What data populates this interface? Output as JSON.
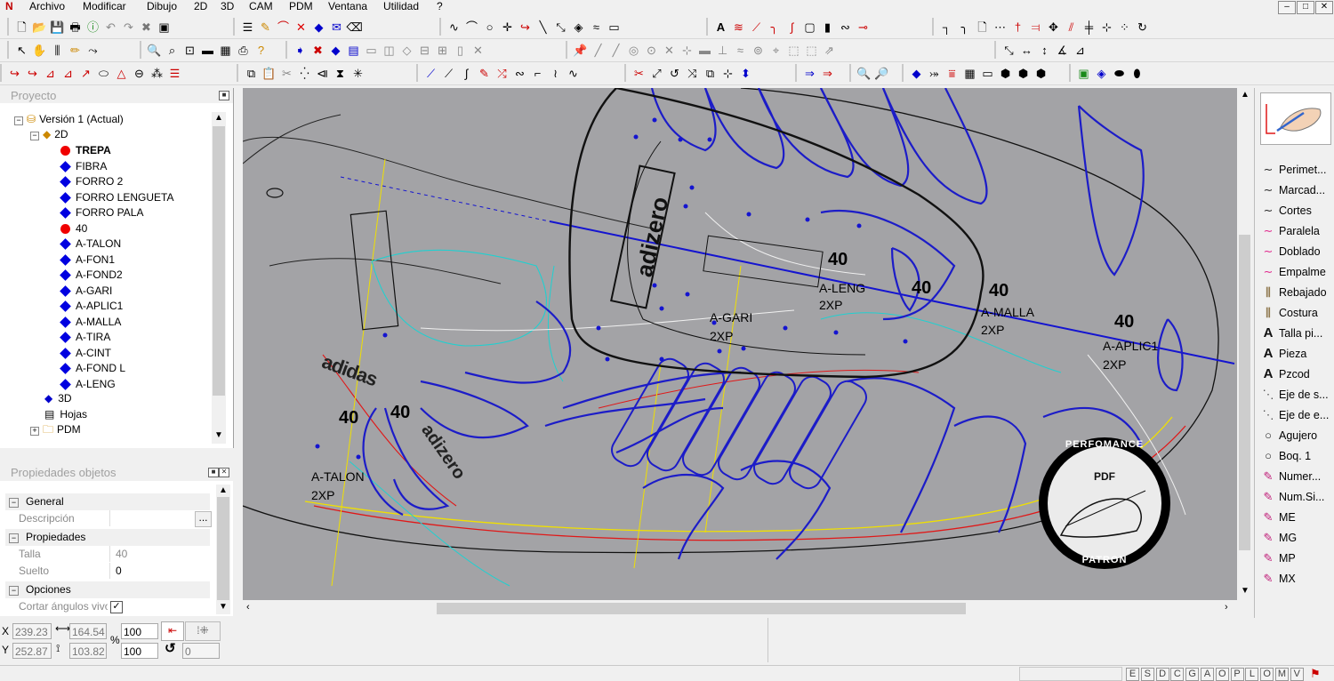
{
  "menu": [
    "Archivo",
    "Modificar",
    "Dibujo",
    "2D",
    "3D",
    "CAM",
    "PDM",
    "Ventana",
    "Utilidad",
    "?"
  ],
  "window_controls": [
    "–",
    "□",
    "✕"
  ],
  "project_panel": {
    "title": "Proyecto",
    "root": "Versión 1 (Actual)",
    "folder_2d": "2D",
    "pieces": [
      {
        "label": "TREPA",
        "color": "red",
        "bold": true
      },
      {
        "label": "FIBRA",
        "color": "blue"
      },
      {
        "label": "FORRO 2",
        "color": "blue"
      },
      {
        "label": "FORRO LENGUETA",
        "color": "blue"
      },
      {
        "label": "FORRO PALA",
        "color": "blue"
      },
      {
        "label": "40",
        "color": "red"
      },
      {
        "label": "A-TALON",
        "color": "blue"
      },
      {
        "label": "A-FON1",
        "color": "blue"
      },
      {
        "label": "A-FOND2",
        "color": "blue"
      },
      {
        "label": "A-GARI",
        "color": "blue"
      },
      {
        "label": "A-APLIC1",
        "color": "blue"
      },
      {
        "label": "A-MALLA",
        "color": "blue"
      },
      {
        "label": "A-TIRA",
        "color": "blue"
      },
      {
        "label": "A-CINT",
        "color": "blue"
      },
      {
        "label": "A-FOND L",
        "color": "blue"
      },
      {
        "label": "A-LENG",
        "color": "blue"
      }
    ],
    "node_3d": "3D",
    "node_hojas": "Hojas",
    "node_pdm": "PDM"
  },
  "props_panel": {
    "title": "Propiedades objetos",
    "general": "General",
    "descripcion_label": "Descripción",
    "descripcion_btn": "...",
    "propiedades": "Propiedades",
    "talla_label": "Talla",
    "talla_value": "40",
    "suelto_label": "Suelto",
    "suelto_value": "0",
    "opciones": "Opciones",
    "cortar_label": "Cortar ángulos vivos",
    "cortar_checked": true
  },
  "coords": {
    "x_label": "X",
    "x_value": "239.23",
    "y_label": "Y",
    "y_value": "252.87",
    "w_value": "164.54",
    "h_value": "103.82",
    "pct_label": "%",
    "scale1": "100",
    "scale2": "100",
    "rot_value": "0"
  },
  "status_keys": [
    "E",
    "S",
    "D",
    "C",
    "G",
    "A",
    "O",
    "P",
    "L",
    "O",
    "M",
    "V"
  ],
  "palette": {
    "items": [
      {
        "icon": "curve",
        "label": "Perimet..."
      },
      {
        "icon": "curve",
        "label": "Marcad..."
      },
      {
        "icon": "curve",
        "label": "Cortes"
      },
      {
        "icon": "curve-pink",
        "label": "Paralela"
      },
      {
        "icon": "curve-pink",
        "label": "Doblado"
      },
      {
        "icon": "curve-pink",
        "label": "Empalme"
      },
      {
        "icon": "stitch",
        "label": "Rebajado"
      },
      {
        "icon": "stitch",
        "label": "Costura"
      },
      {
        "icon": "text-A",
        "label": "Talla pi..."
      },
      {
        "icon": "text-A",
        "label": "Pieza"
      },
      {
        "icon": "text-A",
        "label": "Pzcod"
      },
      {
        "icon": "dash-line",
        "label": "Eje de s..."
      },
      {
        "icon": "dash-line",
        "label": "Eje de e..."
      },
      {
        "icon": "circle",
        "label": "Agujero"
      },
      {
        "icon": "circle",
        "label": "Boq. 1"
      },
      {
        "icon": "pen",
        "label": "Numer..."
      },
      {
        "icon": "pen",
        "label": "Num.Si..."
      },
      {
        "icon": "pen",
        "label": "ME"
      },
      {
        "icon": "pen",
        "label": "MG"
      },
      {
        "icon": "pen",
        "label": "MP"
      },
      {
        "icon": "pen",
        "label": "MX"
      }
    ]
  },
  "canvas_labels": {
    "t_leng": "A-LENG",
    "t_leng_qty": "2XP",
    "t_gari": "A-GARI",
    "t_gari_qty": "2XP",
    "t_malla": "A-MALLA",
    "t_malla_qty": "2XP",
    "t_aplic": "A-APLIC1",
    "t_aplic_qty": "2XP",
    "t_talon": "A-TALON",
    "t_talon_qty": "2XP",
    "size": "40",
    "logo_adidas": "adidas",
    "logo_adizero": "adizero",
    "stamp_top": "PERFOMANCE",
    "stamp_mid": "PDF",
    "stamp_bottom": "PATRON"
  },
  "colors": {
    "canvas_bg": "#a3a3a6",
    "piece_blue": "#1c1cc8",
    "cut_red": "#e01818",
    "axis_yellow": "#f0e000",
    "contour_cyan": "#20d0d0",
    "line_white": "#f0f0f0"
  }
}
